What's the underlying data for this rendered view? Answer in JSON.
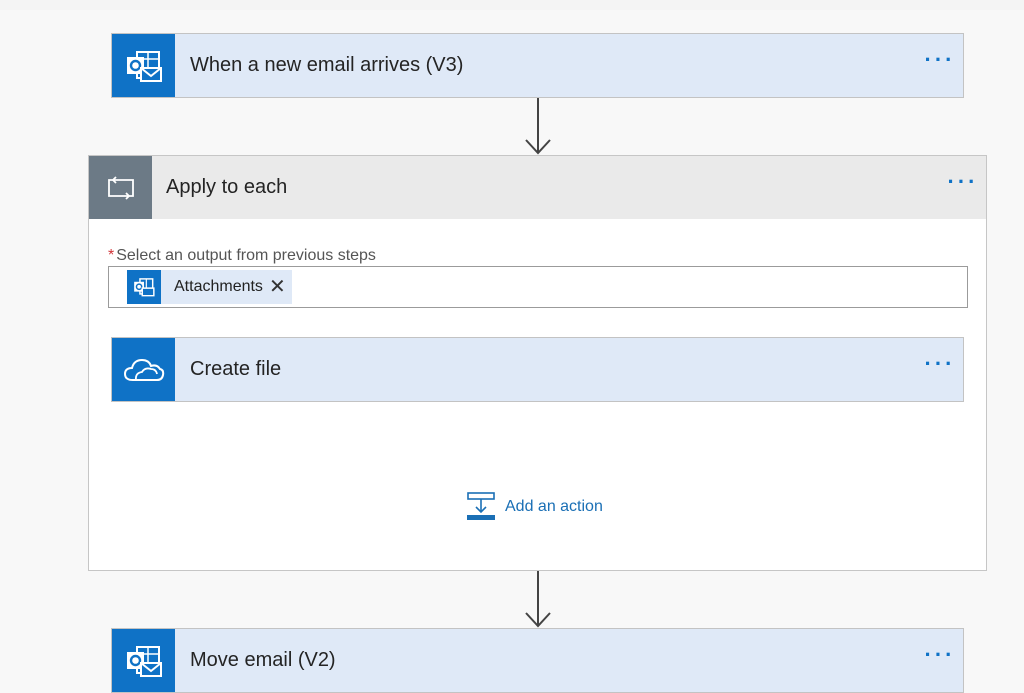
{
  "flow": {
    "trigger": {
      "title": "When a new email arrives (V3)",
      "icon": "outlook-icon",
      "more": "···"
    },
    "loop": {
      "title": "Apply to each",
      "icon": "loop-icon",
      "more": "···",
      "required_mark": "*",
      "field_label": "Select an output from previous steps",
      "token": {
        "label": "Attachments",
        "icon": "outlook-icon",
        "close": "✕"
      },
      "inner_action": {
        "title": "Create file",
        "icon": "onedrive-icon",
        "more": "···"
      },
      "add_action_label": "Add an action"
    },
    "next_action": {
      "title": "Move email (V2)",
      "icon": "outlook-icon",
      "more": "···"
    }
  },
  "colors": {
    "accent": "#0f72c6",
    "card_bg": "#dfe9f7",
    "loop_icon_bg": "#6c7a86",
    "required": "#d13438",
    "link": "#1a6fb5"
  }
}
